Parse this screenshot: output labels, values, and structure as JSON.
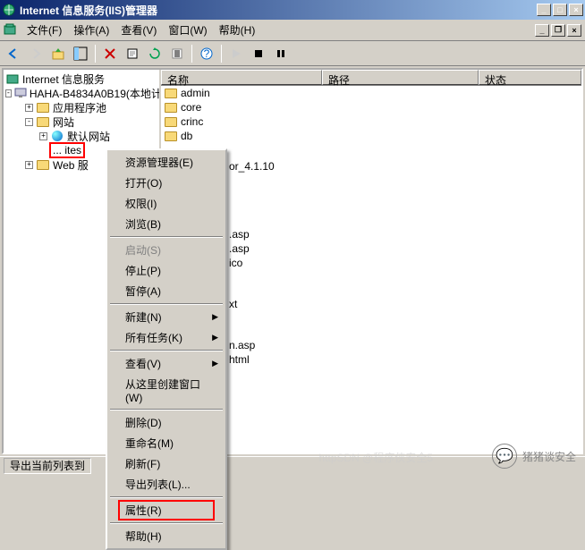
{
  "window": {
    "title": "Internet 信息服务(IIS)管理器"
  },
  "menubar": {
    "file": "文件(F)",
    "action": "操作(A)",
    "view": "查看(V)",
    "window": "窗口(W)",
    "help": "帮助(H)"
  },
  "tree": {
    "root": "Internet 信息服务",
    "host": "HAHA-B4834A0B19(本地计",
    "apppool": "应用程序池",
    "sites": "网站",
    "defaultsite": "默认网站",
    "selected_site": "ites",
    "webserv": "Web 服",
    "selected_prefix": "..."
  },
  "list": {
    "col_name": "名称",
    "col_path": "路径",
    "col_status": "状态",
    "items": {
      "i0": "admin",
      "i1": "core",
      "i2": "crinc",
      "i3": "db",
      "i4": "or_4.1.10",
      "i5": ".asp",
      "i6": ".asp",
      "i7": "ico",
      "i8": "xt",
      "i9": "n.asp",
      "i10": "html"
    }
  },
  "ctx": {
    "explorer": "资源管理器(E)",
    "open": "打开(O)",
    "perm": "权限(I)",
    "browse": "浏览(B)",
    "start": "启动(S)",
    "stop": "停止(P)",
    "pause": "暂停(A)",
    "new": "新建(N)",
    "alltasks": "所有任务(K)",
    "view": "查看(V)",
    "newwin": "从这里创建窗口(W)",
    "delete": "删除(D)",
    "rename": "重命名(M)",
    "refresh": "刷新(F)",
    "export": "导出列表(L)...",
    "props": "属性(R)",
    "help": "帮助(H)"
  },
  "status": {
    "text": "导出当前列表到"
  },
  "watermark": {
    "csdn": "httpSDN @程序侠安全5",
    "wechat": "猪猪谈安全"
  }
}
